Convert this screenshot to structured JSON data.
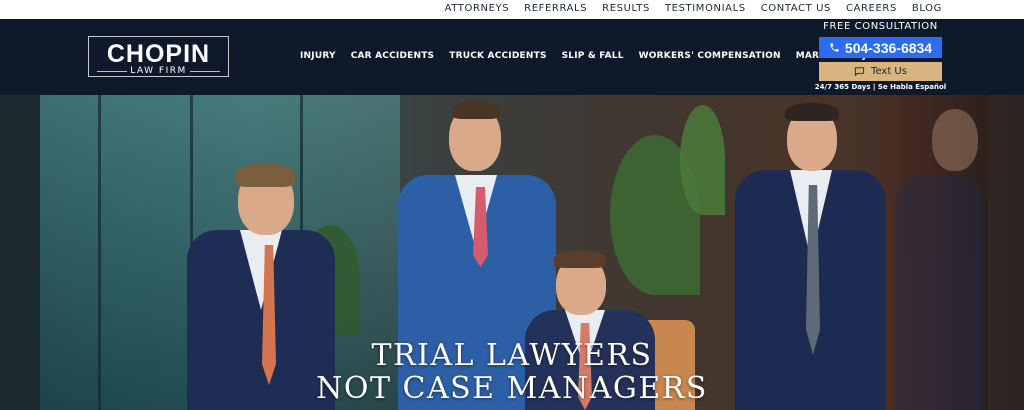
{
  "utility_nav": [
    "ATTORNEYS",
    "REFERRALS",
    "RESULTS",
    "TESTIMONIALS",
    "CONTACT US",
    "CAREERS",
    "BLOG"
  ],
  "logo": {
    "name": "CHOPIN",
    "subtitle": "LAW FIRM"
  },
  "main_nav": [
    "INJURY",
    "CAR ACCIDENTS",
    "TRUCK ACCIDENTS",
    "SLIP & FALL",
    "WORKERS' COMPENSATION",
    "MARITIME INJURY"
  ],
  "cta": {
    "consult_label": "FREE CONSULTATION",
    "phone": "504-336-6834",
    "text_us": "Text Us",
    "hours": "24/7 365 Days | Se Habla Español"
  },
  "hero": {
    "line1": "TRIAL LAWYERS",
    "line2": "NOT CASE MANAGERS"
  },
  "colors": {
    "header_bg": "#0e1a2b",
    "phone_button": "#2a6df2",
    "text_button": "#d8b57f"
  },
  "icons": {
    "phone": "phone-icon",
    "text": "chat-bubble-icon"
  }
}
